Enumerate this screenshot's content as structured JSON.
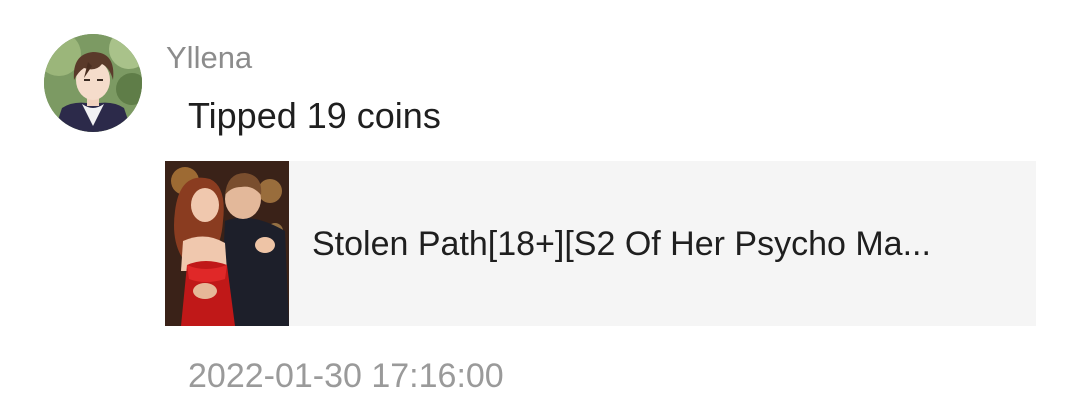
{
  "comment": {
    "username": "Yllena",
    "message": "Tipped 19 coins",
    "timestamp": "2022-01-30 17:16:00"
  },
  "book": {
    "title": "Stolen Path[18+][S2 Of Her Psycho Ma..."
  },
  "icons": {
    "avatar": "user-avatar-image",
    "cover": "book-cover-image"
  },
  "colors": {
    "username": "#8c8c8c",
    "message": "#1f1f1f",
    "card_background": "#f5f5f5",
    "timestamp": "#9a9a9a"
  }
}
